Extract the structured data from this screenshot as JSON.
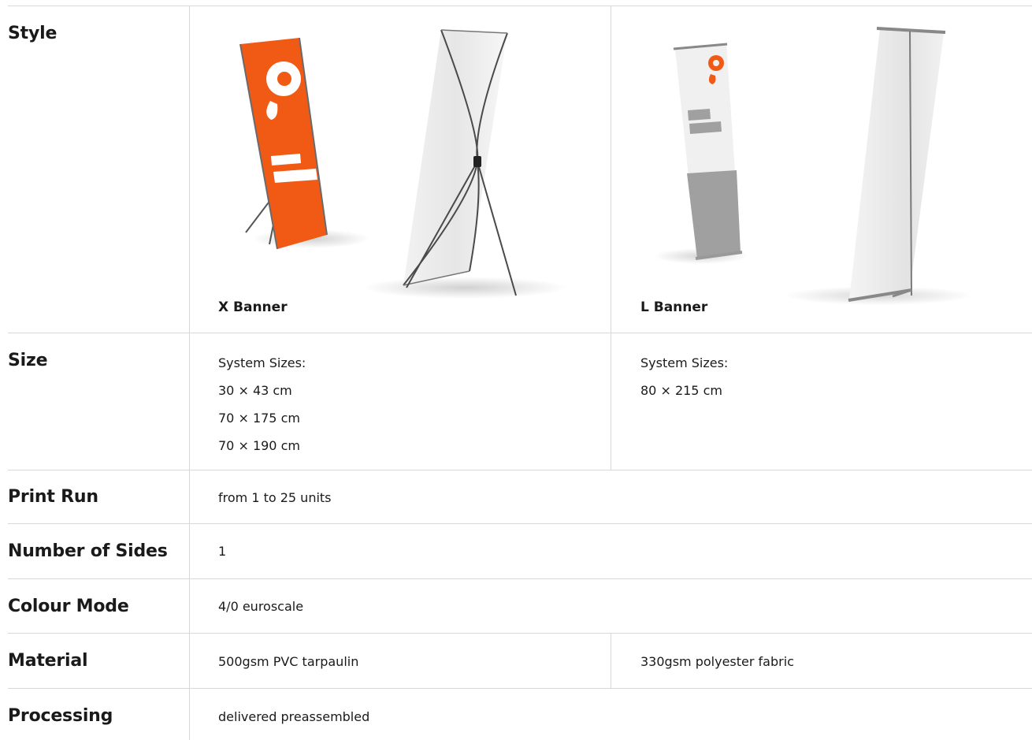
{
  "rows": {
    "style": {
      "label": "Style",
      "options": [
        {
          "caption": "X Banner",
          "image_icon": "x-banner-stand-image"
        },
        {
          "caption": "L Banner",
          "image_icon": "l-banner-stand-image"
        }
      ]
    },
    "size": {
      "label": "Size",
      "x_banner": {
        "heading": "System Sizes:",
        "sizes": [
          "30 × 43 cm",
          "70 × 175 cm",
          "70 × 190 cm"
        ]
      },
      "l_banner": {
        "heading": "System Sizes:",
        "sizes": [
          "80 × 215 cm"
        ]
      }
    },
    "print_run": {
      "label": "Print Run",
      "value": "from 1 to 25 units"
    },
    "sides": {
      "label": "Number of Sides",
      "value": "1"
    },
    "colour_mode": {
      "label": "Colour Mode",
      "value": "4/0 euroscale"
    },
    "material": {
      "label": "Material",
      "x_banner": "500gsm PVC tarpaulin",
      "l_banner": "330gsm polyester fabric"
    },
    "processing": {
      "label": "Processing",
      "value": "delivered preassembled"
    }
  },
  "colors": {
    "accent": "#f05a14",
    "border": "#d8d8d8",
    "text": "#1a1a1a"
  }
}
